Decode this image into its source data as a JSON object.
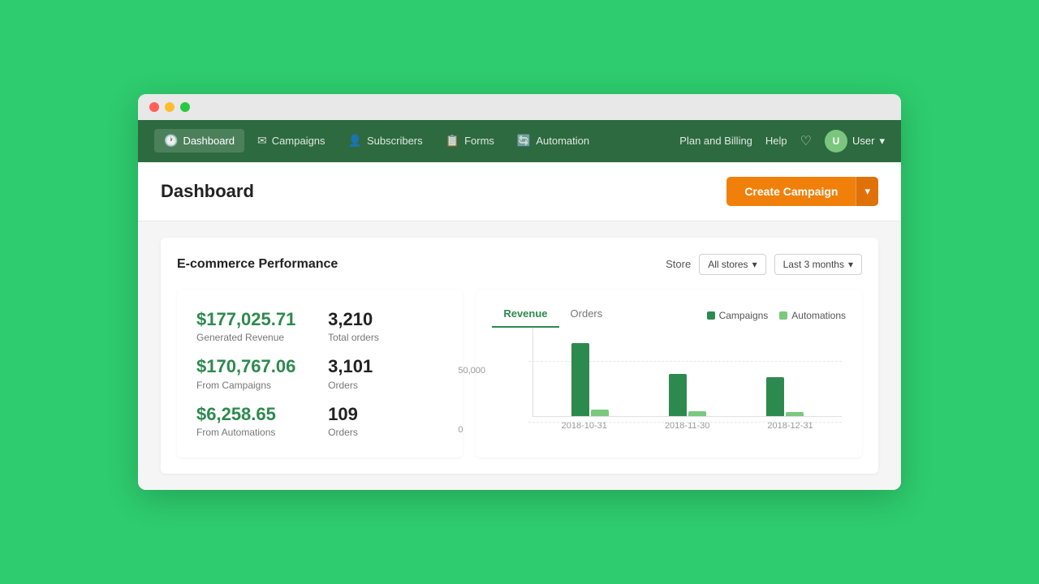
{
  "window": {
    "dots": [
      "red",
      "yellow",
      "green"
    ]
  },
  "navbar": {
    "items": [
      {
        "id": "dashboard",
        "label": "Dashboard",
        "icon": "🕐",
        "active": true
      },
      {
        "id": "campaigns",
        "label": "Campaigns",
        "icon": "✉"
      },
      {
        "id": "subscribers",
        "label": "Subscribers",
        "icon": "👤"
      },
      {
        "id": "forms",
        "label": "Forms",
        "icon": "📋"
      },
      {
        "id": "automation",
        "label": "Automation",
        "icon": "🔄"
      }
    ],
    "right": {
      "plan_billing": "Plan and Billing",
      "help": "Help",
      "user_label": "User",
      "dropdown_arrow": "▾"
    }
  },
  "page": {
    "title": "Dashboard",
    "create_btn": "Create Campaign",
    "create_arrow": "▾"
  },
  "ecommerce": {
    "section_title": "E-commerce Performance",
    "store_label": "Store",
    "store_filter": "All stores",
    "store_arrow": "▾",
    "time_filter": "Last 3 months",
    "time_arrow": "▾",
    "stats": {
      "generated_revenue": "$177,025.71",
      "generated_revenue_label": "Generated Revenue",
      "total_orders": "3,210",
      "total_orders_label": "Total orders",
      "campaign_revenue": "$170,767.06",
      "campaign_revenue_label": "From Campaigns",
      "campaign_orders": "3,101",
      "campaign_orders_label": "Orders",
      "automation_revenue": "$6,258.65",
      "automation_revenue_label": "From Automations",
      "automation_orders": "109",
      "automation_orders_label": "Orders"
    },
    "chart": {
      "tabs": [
        "Revenue",
        "Orders"
      ],
      "active_tab": "Revenue",
      "legend": {
        "campaigns_label": "Campaigns",
        "automations_label": "Automations"
      },
      "y_label_top": "50,000",
      "y_label_bottom": "0",
      "bars": [
        {
          "date": "2018-10-31",
          "campaign_height": 90,
          "automation_height": 8
        },
        {
          "date": "2018-11-30",
          "campaign_height": 52,
          "automation_height": 6
        },
        {
          "date": "2018-12-31",
          "campaign_height": 48,
          "automation_height": 5
        }
      ]
    }
  }
}
